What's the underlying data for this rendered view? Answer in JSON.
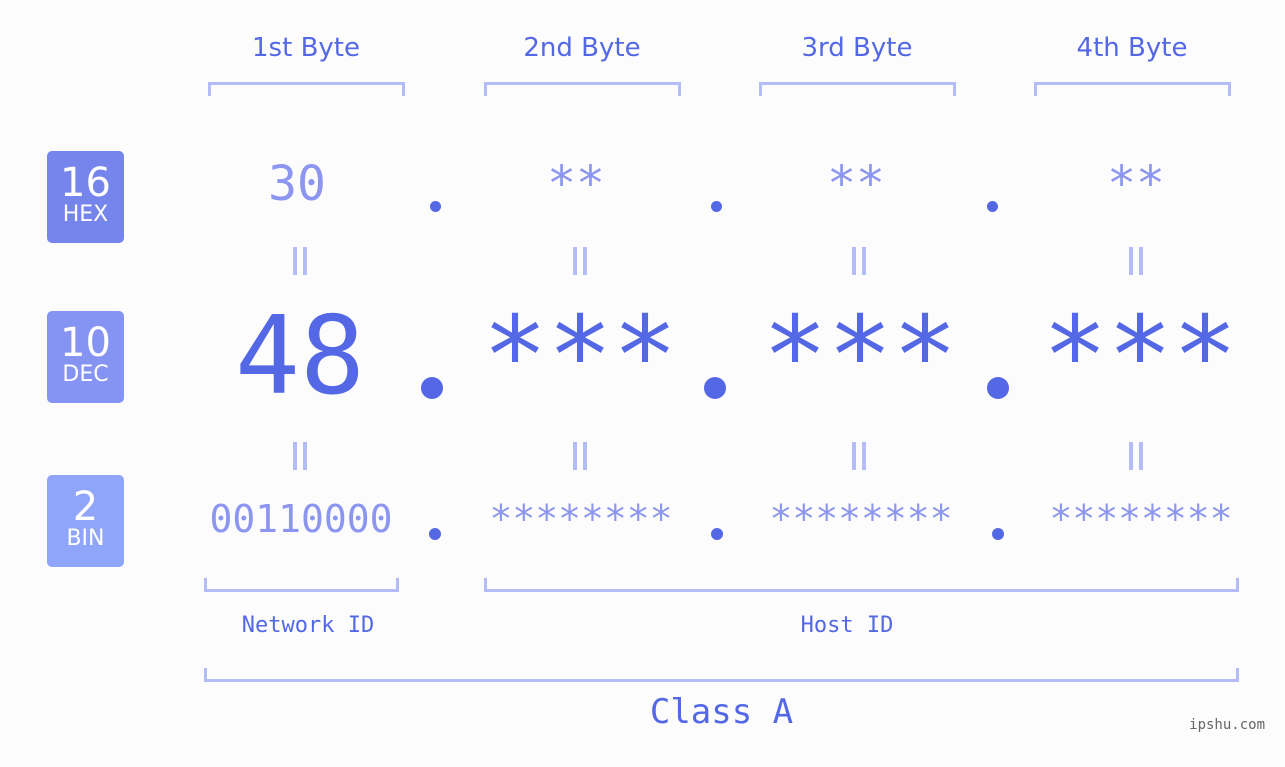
{
  "bytes": [
    {
      "header": "1st Byte",
      "hex": "30",
      "dec": "48",
      "bin": "00110000"
    },
    {
      "header": "2nd Byte",
      "hex": "**",
      "dec": "***",
      "bin": "********"
    },
    {
      "header": "3rd Byte",
      "hex": "**",
      "dec": "***",
      "bin": "********"
    },
    {
      "header": "4th Byte",
      "hex": "**",
      "dec": "***",
      "bin": "********"
    }
  ],
  "bases": [
    {
      "number": "16",
      "label": "HEX",
      "color": "#7585ec"
    },
    {
      "number": "10",
      "label": "DEC",
      "color": "#8594f2"
    },
    {
      "number": "2",
      "label": "BIN",
      "color": "#8fa5f9"
    }
  ],
  "network_id_label": "Network ID",
  "host_id_label": "Host ID",
  "class_label": "Class A",
  "credit": "ipshu.com",
  "colors": {
    "accent": "#5468e6",
    "light": "#8c96f0",
    "bracket": "#b3bcf6"
  }
}
